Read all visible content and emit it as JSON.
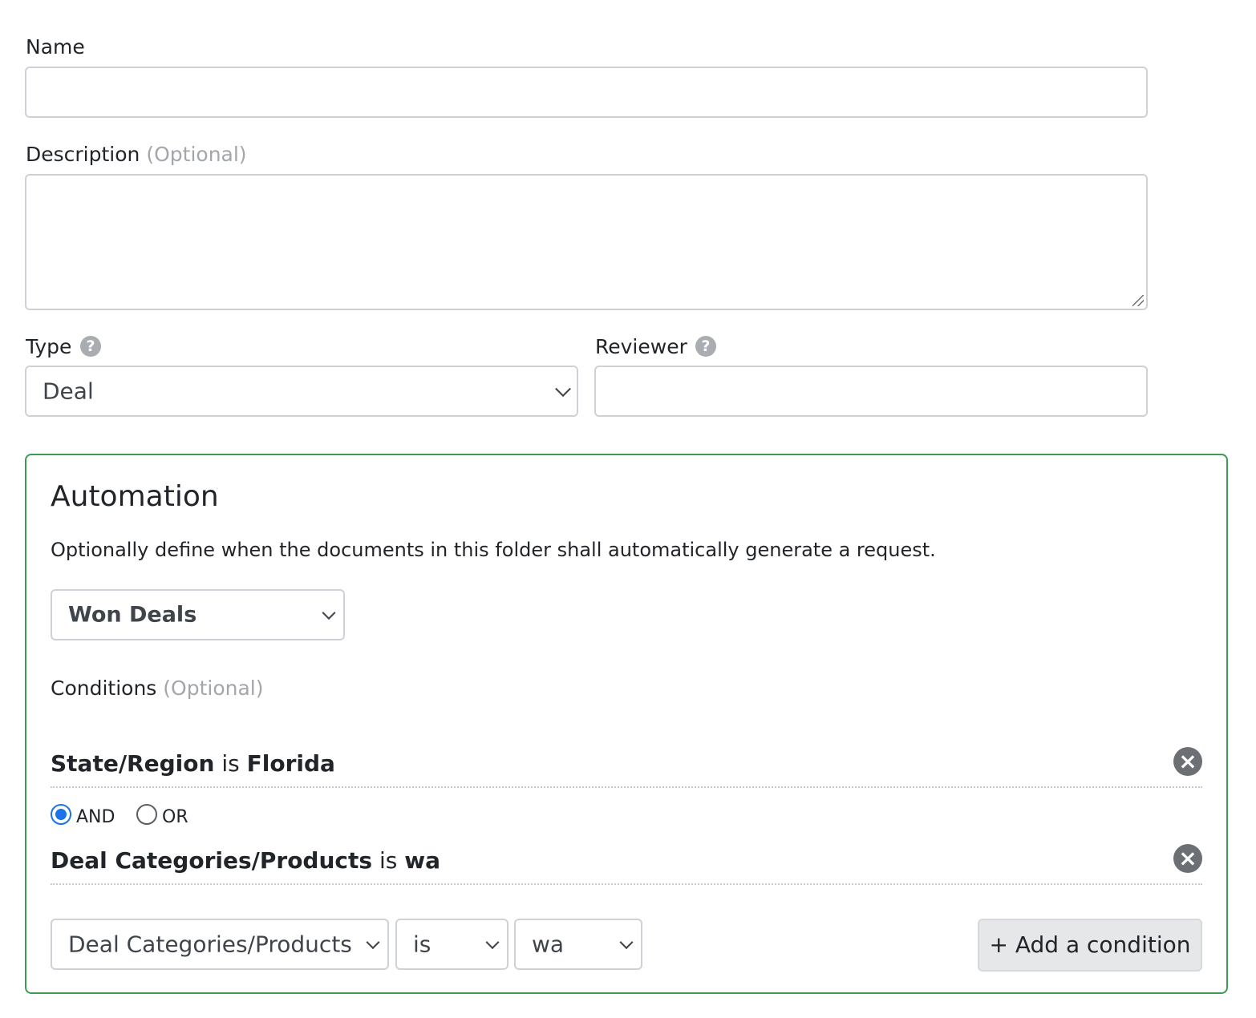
{
  "name": {
    "label": "Name",
    "value": ""
  },
  "description": {
    "label": "Description",
    "optional_hint": "(Optional)",
    "value": ""
  },
  "type": {
    "label": "Type",
    "help_icon": "question-circle-icon",
    "selected": "Deal"
  },
  "reviewer": {
    "label": "Reviewer",
    "help_icon": "question-circle-icon",
    "value": ""
  },
  "automation": {
    "title": "Automation",
    "description": "Optionally define when the documents in this folder shall automatically generate a request.",
    "trigger_selected": "Won Deals",
    "conditions_label": "Conditions",
    "conditions_optional": "(Optional)",
    "conditions": [
      {
        "field": "State/Region",
        "operator": "is",
        "value": "Florida"
      },
      {
        "field": "Deal Categories/Products",
        "operator": "is",
        "value": "wa"
      }
    ],
    "logic": {
      "and_label": "AND",
      "or_label": "OR",
      "selected": "AND"
    },
    "builder": {
      "field_selected": "Deal Categories/Products",
      "operator_selected": "is",
      "value_selected": "wa",
      "add_button_label": "+ Add a condition"
    },
    "border_color": "#3d9b53"
  }
}
